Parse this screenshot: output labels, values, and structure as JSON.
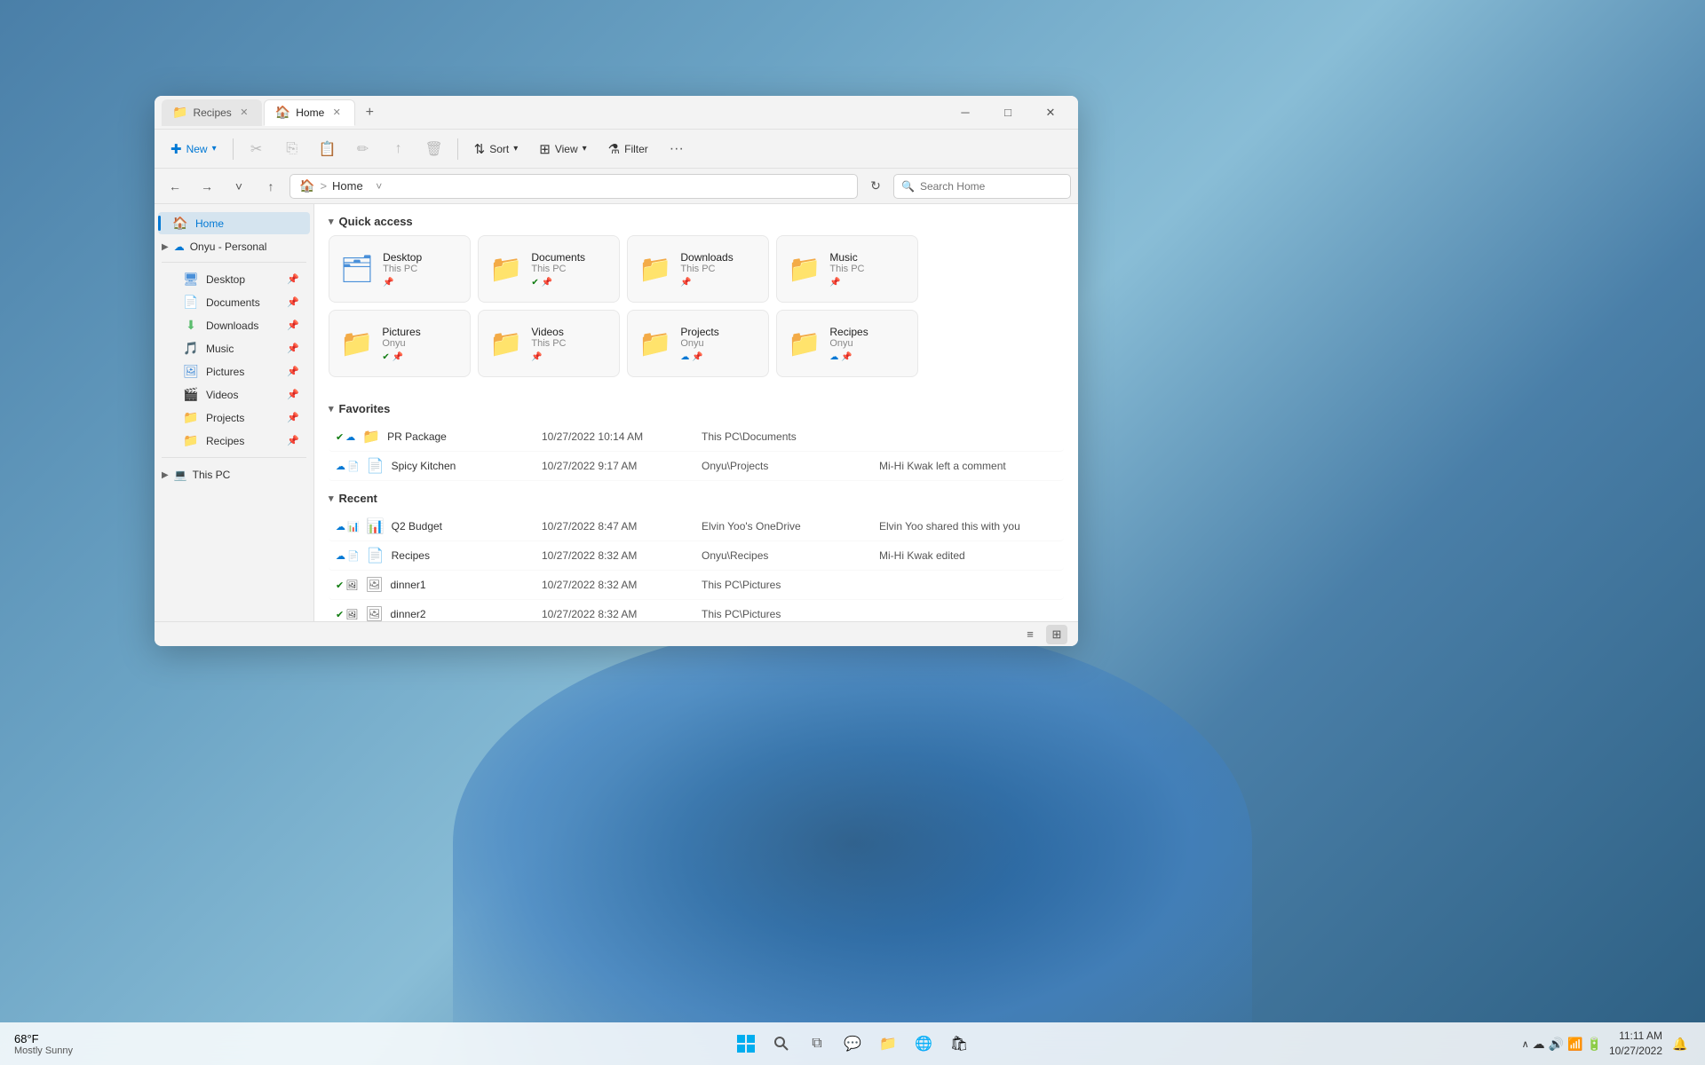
{
  "desktop": {
    "bg_class": "desktop-bg"
  },
  "taskbar": {
    "weather_temp": "68°F",
    "weather_desc": "Mostly Sunny",
    "time": "11:11 AM",
    "date": "10/27/2022",
    "start_icon": "⊞",
    "search_icon": "🔍",
    "taskview_icon": "⧉",
    "chat_icon": "💬",
    "explorer_icon": "📁",
    "edge_icon": "🌐",
    "store_icon": "🛍",
    "systray_icons": [
      "∧",
      "☁",
      "🔊",
      "📶",
      "🔋"
    ]
  },
  "window": {
    "tabs": [
      {
        "id": "recipes",
        "label": "Recipes",
        "icon": "📁",
        "active": false
      },
      {
        "id": "home",
        "label": "Home",
        "icon": "🏠",
        "active": true
      }
    ],
    "tab_new_label": "+",
    "controls": {
      "minimize": "─",
      "maximize": "□",
      "close": "✕"
    }
  },
  "toolbar": {
    "new_label": "New",
    "cut_icon": "✂",
    "copy_icon": "⎘",
    "paste_icon": "📋",
    "rename_icon": "✏",
    "share_icon": "↑",
    "delete_icon": "🗑",
    "sort_label": "Sort",
    "view_label": "View",
    "filter_label": "Filter",
    "more_label": "···"
  },
  "addressbar": {
    "back_icon": "←",
    "forward_icon": "→",
    "dropdown_icon": "˅",
    "up_icon": "↑",
    "home_icon": "🏠",
    "path_separator": ">",
    "path_text": "Home",
    "refresh_icon": "↻",
    "search_placeholder": "Search Home"
  },
  "sidebar": {
    "home_label": "Home",
    "home_icon": "🏠",
    "onedrive_label": "Onyu - Personal",
    "onedrive_icon": "☁",
    "items": [
      {
        "id": "desktop",
        "label": "Desktop",
        "icon": "🖥",
        "pinned": true
      },
      {
        "id": "documents",
        "label": "Documents",
        "icon": "📄",
        "pinned": true
      },
      {
        "id": "downloads",
        "label": "Downloads",
        "icon": "⬇",
        "pinned": true
      },
      {
        "id": "music",
        "label": "Music",
        "icon": "🎵",
        "pinned": true
      },
      {
        "id": "pictures",
        "label": "Pictures",
        "icon": "🖼",
        "pinned": true
      },
      {
        "id": "videos",
        "label": "Videos",
        "icon": "🎬",
        "pinned": true
      },
      {
        "id": "projects",
        "label": "Projects",
        "icon": "📁",
        "pinned": true
      },
      {
        "id": "recipes",
        "label": "Recipes",
        "icon": "📁",
        "pinned": true
      }
    ],
    "this_pc_label": "This PC",
    "this_pc_icon": "💻"
  },
  "quick_access": {
    "section_label": "Quick access",
    "folders": [
      {
        "id": "desktop",
        "name": "Desktop",
        "sub": "This PC",
        "icon": "🗂",
        "icon_color": "#4a90d9",
        "badges": [
          "pin"
        ]
      },
      {
        "id": "documents",
        "name": "Documents",
        "sub": "This PC",
        "icon": "📁",
        "icon_color": "#4a90d9",
        "badges": [
          "check",
          "pin"
        ]
      },
      {
        "id": "downloads",
        "name": "Downloads",
        "sub": "This PC",
        "icon": "📁",
        "icon_color": "#5bbd6e",
        "badges": [
          "pin"
        ]
      },
      {
        "id": "music",
        "name": "Music",
        "sub": "This PC",
        "icon": "📁",
        "icon_color": "#e86b5f",
        "badges": [
          "pin"
        ]
      },
      {
        "id": "pictures",
        "name": "Pictures",
        "sub": "Onyu",
        "icon": "📁",
        "icon_color": "#4a90d9",
        "badges": [
          "check",
          "pin"
        ]
      },
      {
        "id": "videos",
        "name": "Videos",
        "sub": "This PC",
        "icon": "📁",
        "icon_color": "#9b59b6",
        "badges": [
          "pin"
        ]
      },
      {
        "id": "projects",
        "name": "Projects",
        "sub": "Onyu",
        "icon": "📁",
        "icon_color": "#f5c542",
        "badges": [
          "sync",
          "pin"
        ]
      },
      {
        "id": "recipes",
        "name": "Recipes",
        "sub": "Onyu",
        "icon": "📁",
        "icon_color": "#f5c542",
        "badges": [
          "sync",
          "pin"
        ]
      }
    ]
  },
  "favorites": {
    "section_label": "Favorites",
    "items": [
      {
        "id": "pr-package",
        "name": "PR Package",
        "date": "10/27/2022 10:14 AM",
        "location": "This PC\\Documents",
        "activity": "",
        "status": [
          "check",
          "cloud"
        ],
        "icon": "📁",
        "icon_color": "#e86b5f"
      },
      {
        "id": "spicy-kitchen",
        "name": "Spicy Kitchen",
        "date": "10/27/2022 9:17 AM",
        "location": "Onyu\\Projects",
        "activity": "Mi-Hi Kwak left a comment",
        "status": [
          "cloud",
          "doc"
        ],
        "icon": "📄",
        "icon_color": "#1e88e5"
      }
    ]
  },
  "recent": {
    "section_label": "Recent",
    "items": [
      {
        "id": "q2-budget",
        "name": "Q2 Budget",
        "date": "10/27/2022 8:47 AM",
        "location": "Elvin Yoo's OneDrive",
        "activity": "Elvin Yoo shared this with you",
        "status": [
          "cloud",
          "doc"
        ],
        "icon": "📊"
      },
      {
        "id": "recipes",
        "name": "Recipes",
        "date": "10/27/2022 8:32 AM",
        "location": "Onyu\\Recipes",
        "activity": "Mi-Hi Kwak edited",
        "status": [
          "cloud",
          "doc"
        ],
        "icon": "📄"
      },
      {
        "id": "dinner1",
        "name": "dinner1",
        "date": "10/27/2022 8:32 AM",
        "location": "This PC\\Pictures",
        "activity": "",
        "status": [
          "check"
        ],
        "icon": "🖼"
      },
      {
        "id": "dinner2",
        "name": "dinner2",
        "date": "10/27/2022 8:32 AM",
        "location": "This PC\\Pictures",
        "activity": "",
        "status": [
          "check"
        ],
        "icon": "🖼"
      }
    ]
  },
  "statusbar": {
    "list_view_icon": "≡",
    "grid_view_icon": "⊞"
  },
  "folder_colors": {
    "desktop": "#4a90d9",
    "documents": "#4a90d9",
    "downloads": "#5bbd6e",
    "music": "#e86b5f",
    "pictures": "#4a90d9",
    "videos": "#9b59b6",
    "projects": "#f5c542",
    "recipes": "#f5c542"
  }
}
